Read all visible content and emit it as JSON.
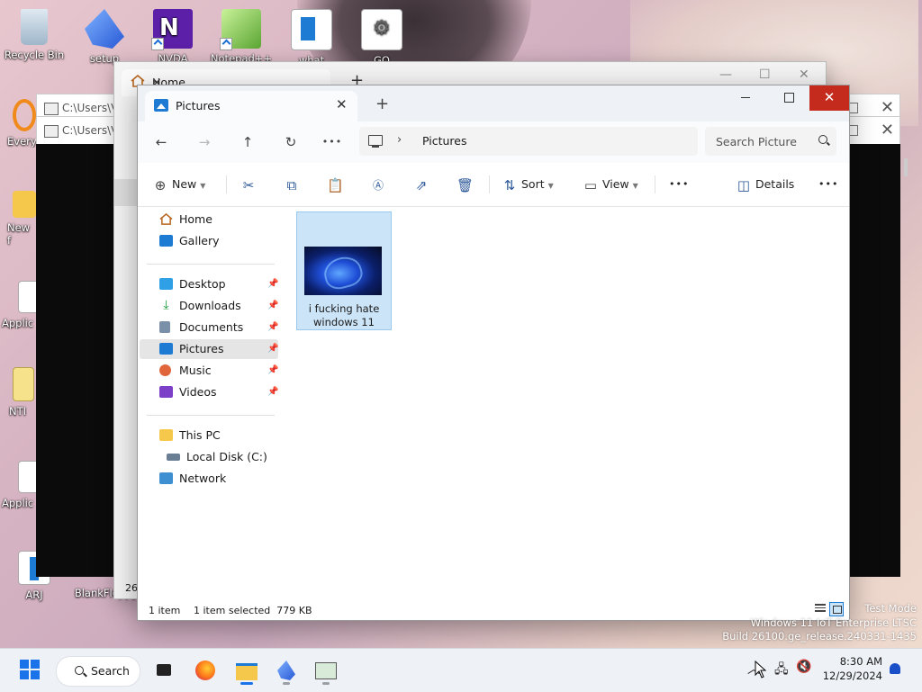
{
  "desktop": {
    "icons": [
      {
        "label": "Recycle Bin",
        "icon": "recycle-bin-icon"
      },
      {
        "label": "setup",
        "icon": "setup-icon"
      },
      {
        "label": "NVDA",
        "icon": "nvda-icon"
      },
      {
        "label": "Notepad++",
        "icon": "notepad-plus-plus-icon"
      },
      {
        "label": "what",
        "icon": "document-icon"
      },
      {
        "label": "GO",
        "icon": "settings-gear-icon"
      },
      {
        "label": "Every",
        "icon": "everything-search-icon"
      },
      {
        "label": "New f",
        "icon": "folder-icon"
      },
      {
        "label": "Applic",
        "icon": "application-icon"
      },
      {
        "label": "NTI",
        "icon": "zip-folder-icon"
      },
      {
        "label": "Applic",
        "icon": "application-icon"
      },
      {
        "label": "ARJ",
        "icon": "archive-icon"
      },
      {
        "label": "BlankFloppy",
        "icon": "floppy-icon"
      }
    ]
  },
  "bg_windows": {
    "cmd1_title": "C:\\Users\\V",
    "cmd2_title": "C:\\Users\\V",
    "home_tab": "Home",
    "home_bottom": "26"
  },
  "window": {
    "tab_label": "Pictures",
    "new_tab": "+",
    "close_glyph": "✕"
  },
  "nav": {
    "back": "←",
    "forward": "→",
    "up": "↑",
    "refresh": "↻",
    "more": "•••",
    "crumb_sep": "›",
    "crumb": "Pictures",
    "search_placeholder": "Search Picture"
  },
  "toolbar": {
    "new_label": "New",
    "sort_label": "Sort",
    "view_label": "View",
    "more": "•••",
    "details_label": "Details",
    "more2": "•••"
  },
  "sidebar": {
    "items": [
      {
        "label": "Home",
        "icon": "home-icon"
      },
      {
        "label": "Gallery",
        "icon": "gallery-icon"
      },
      {
        "label": "Desktop",
        "icon": "desktop-icon",
        "pinned": true
      },
      {
        "label": "Downloads",
        "icon": "downloads-icon",
        "pinned": true
      },
      {
        "label": "Documents",
        "icon": "documents-icon",
        "pinned": true
      },
      {
        "label": "Pictures",
        "icon": "pictures-icon",
        "pinned": true,
        "selected": true
      },
      {
        "label": "Music",
        "icon": "music-icon",
        "pinned": true
      },
      {
        "label": "Videos",
        "icon": "videos-icon",
        "pinned": true
      },
      {
        "label": "This PC",
        "icon": "this-pc-icon"
      },
      {
        "label": "Local Disk (C:)",
        "icon": "local-disk-icon"
      },
      {
        "label": "Network",
        "icon": "network-icon"
      }
    ]
  },
  "files": [
    {
      "name_line1": "i fucking hate",
      "name_line2": "windows 11"
    }
  ],
  "status": {
    "count": "1 item",
    "selection": "1 item selected  779 KB"
  },
  "watermark": {
    "line1": "Test Mode",
    "line2": "Windows 11 IoT Enterprise LTSC",
    "line3": "Build 26100.ge_release.240331-1435"
  },
  "taskbar": {
    "search_label": "Search",
    "time": "8:30 AM",
    "date": "12/29/2024"
  },
  "colors": {
    "accent": "#1e7bd4",
    "close_red": "#c42b1c",
    "selection": "#cce4f7"
  }
}
